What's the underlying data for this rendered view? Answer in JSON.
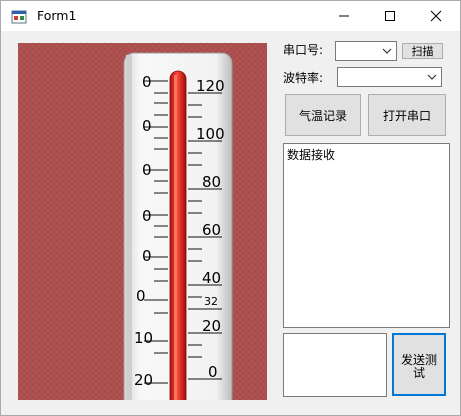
{
  "window": {
    "title": "Form1",
    "controls": {
      "minimize_icon": "minimize-icon",
      "maximize_icon": "maximize-icon",
      "close_icon": "close-icon"
    }
  },
  "serial": {
    "port_label": "串口号:",
    "port_value": "",
    "scan_label": "扫描",
    "baud_label": "波特率:",
    "baud_value": ""
  },
  "actions": {
    "record_label": "气温记录",
    "open_label": "打开串口",
    "send_label": "发送测试"
  },
  "receive": {
    "text": "数据接收"
  },
  "send": {
    "text": ""
  },
  "thermometer": {
    "right_scale": [
      "120",
      "100",
      "80",
      "60",
      "40",
      "32",
      "20",
      "0"
    ],
    "left_scale": [
      "0",
      "0",
      "0",
      "0",
      "0",
      "0",
      "10",
      "20"
    ]
  },
  "colors": {
    "picture_bg": "#a94c4c",
    "mercury": "#e02020",
    "accent": "#0078d7"
  }
}
